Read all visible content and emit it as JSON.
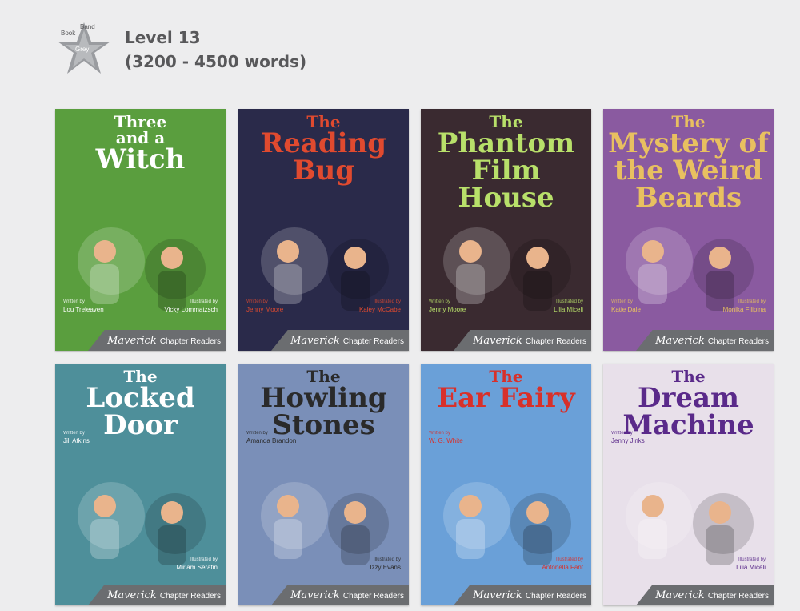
{
  "header": {
    "badge": {
      "line1": "Book",
      "line2": "Band",
      "colour": "Grey"
    },
    "level": "Level 13",
    "words": "(3200 - 4500 words)"
  },
  "brand": {
    "name": "Maverick",
    "series": "Chapter Readers"
  },
  "books": [
    {
      "title_top": "Three",
      "title_mid": "and a",
      "title_main": "Witch",
      "written_label": "Written by",
      "author": "Lou Treleaven",
      "illustrated_label": "Illustrated by",
      "illustrator": "Vicky Lommatzsch",
      "bg": "#5a9e3e",
      "accent": "#ffffff"
    },
    {
      "title_top": "The",
      "title_mid": "",
      "title_main": "Reading Bug",
      "written_label": "Written by",
      "author": "Jenny Moore",
      "illustrated_label": "Illustrated by",
      "illustrator": "Kaley McCabe",
      "bg": "#2a2a4a",
      "accent": "#e04a2f"
    },
    {
      "title_top": "The",
      "title_mid": "",
      "title_main": "Phantom Film House",
      "written_label": "Written by",
      "author": "Jenny Moore",
      "illustrated_label": "Illustrated by",
      "illustrator": "Lilia Miceli",
      "bg": "#3a2a30",
      "accent": "#b8e06a"
    },
    {
      "title_top": "The",
      "title_mid": "",
      "title_main": "Mystery of the Weird Beards",
      "written_label": "Written by",
      "author": "Katie Dale",
      "illustrated_label": "Illustrated by",
      "illustrator": "Monika Filipina",
      "bg": "#8a5aa0",
      "accent": "#e8c060"
    },
    {
      "title_top": "The",
      "title_mid": "",
      "title_main": "Locked Door",
      "written_label": "Written by",
      "author": "Jill Atkins",
      "illustrated_label": "Illustrated by",
      "illustrator": "Miriam Serafin",
      "bg": "#4e8f9a",
      "accent": "#ffffff"
    },
    {
      "title_top": "The",
      "title_mid": "",
      "title_main": "Howling Stones",
      "written_label": "Written by",
      "author": "Amanda Brandon",
      "illustrated_label": "Illustrated by",
      "illustrator": "Izzy Evans",
      "bg": "#7a8fb8",
      "accent": "#2a2a2a"
    },
    {
      "title_top": "The",
      "title_mid": "",
      "title_main": "Ear Fairy",
      "written_label": "Written by",
      "author": "W. G. White",
      "illustrated_label": "Illustrated by",
      "illustrator": "Antonella Fant",
      "bg": "#6aa0d8",
      "accent": "#d8302a"
    },
    {
      "title_top": "The",
      "title_mid": "",
      "title_main": "Dream Machine",
      "written_label": "Written by",
      "author": "Jenny Jinks",
      "illustrated_label": "Illustrated by",
      "illustrator": "Lilia Miceli",
      "bg": "#e8e0ea",
      "accent": "#5a2a8a"
    }
  ]
}
